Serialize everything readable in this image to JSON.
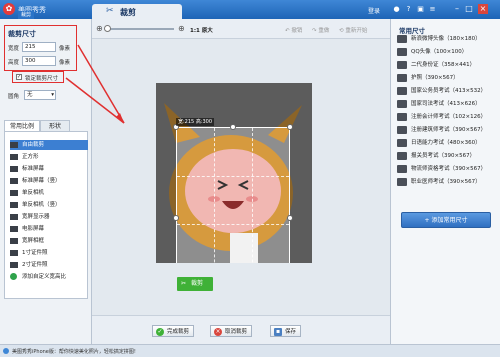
{
  "window": {
    "app_title": "美图秀秀",
    "section": "裁剪",
    "crumb": "返回"
  },
  "header": {
    "active_tab": "裁剪",
    "login": "登录"
  },
  "toolbar": {
    "zoom_label": "1:1 原大",
    "undo": "撤销",
    "redo": "重做",
    "reset": "重新开始"
  },
  "left": {
    "section_title": "裁剪尺寸",
    "width_label": "宽度",
    "width_value": "215",
    "height_label": "高度",
    "height_value": "300",
    "unit": "像素",
    "lock_label": "锁定裁剪尺寸",
    "round_label": "圆角",
    "round_value": "无",
    "tab_ratio": "常用比例",
    "tab_shape": "形状",
    "ratios": [
      "自由裁剪",
      "正方形",
      "标准屏幕",
      "标准屏幕（竖）",
      "单反相机",
      "单反相机（竖）",
      "宽屏显示器",
      "电影屏幕",
      "宽屏相框",
      "1寸证件照",
      "2寸证件照",
      "添加自定义宽高比"
    ]
  },
  "canvas": {
    "size_tag": "宽:215  高:300",
    "crop_button": "裁剪"
  },
  "bottom": {
    "finish": "完成裁剪",
    "cancel": "取消裁剪",
    "save": "保存"
  },
  "right": {
    "title": "常用尺寸",
    "items": [
      "新浪微博头像（180×180）",
      "QQ头像（100×100）",
      "二代身份证（358×441）",
      "护照（390×567）",
      "国家公务员考试（413×532）",
      "国家司法考试（413×626）",
      "注册会计师考试（102×126）",
      "注册建筑师考试（390×567）",
      "日语能力考试（480×360）",
      "报关员考试（390×567）",
      "物流师资格考试（390×567）",
      "职业医师考试（390×567）"
    ],
    "add_button": "添加常用尺寸"
  },
  "status": {
    "text": "美图秀秀iPhone版：帮你快速美化照片，轻松搞定拼图!"
  }
}
